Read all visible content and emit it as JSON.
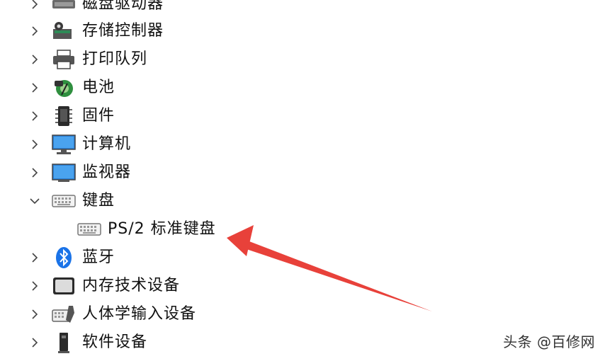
{
  "tree": {
    "items": [
      {
        "label": "磁盘驱动器",
        "icon": "disk-drive-icon",
        "expanded": false
      },
      {
        "label": "存储控制器",
        "icon": "storage-controller-icon",
        "expanded": false
      },
      {
        "label": "打印队列",
        "icon": "printer-icon",
        "expanded": false
      },
      {
        "label": "电池",
        "icon": "battery-icon",
        "expanded": false
      },
      {
        "label": "固件",
        "icon": "firmware-icon",
        "expanded": false
      },
      {
        "label": "计算机",
        "icon": "computer-icon",
        "expanded": false
      },
      {
        "label": "监视器",
        "icon": "monitor-icon",
        "expanded": false
      },
      {
        "label": "键盘",
        "icon": "keyboard-icon",
        "expanded": true
      },
      {
        "label": "PS/2 标准键盘",
        "icon": "keyboard-icon",
        "child": true
      },
      {
        "label": "蓝牙",
        "icon": "bluetooth-icon",
        "expanded": false
      },
      {
        "label": "内存技术设备",
        "icon": "memory-device-icon",
        "expanded": false
      },
      {
        "label": "人体学输入设备",
        "icon": "hid-icon",
        "expanded": false
      },
      {
        "label": "软件设备",
        "icon": "software-device-icon",
        "expanded": false
      }
    ]
  },
  "watermark": "头条 @百修网",
  "colors": {
    "arrow": "#e8413a",
    "accent": "#1a73e8"
  }
}
